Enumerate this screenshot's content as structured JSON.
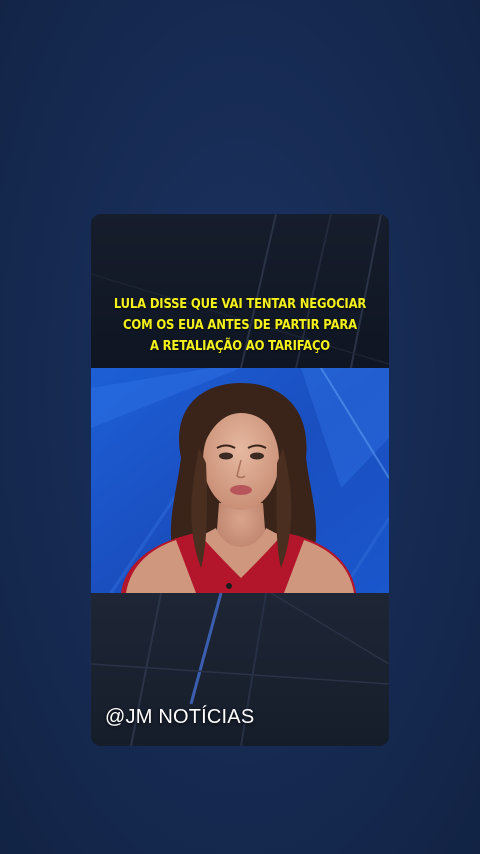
{
  "screen": {
    "background_color": "#172a4f"
  },
  "video": {
    "headline_lines": [
      "LULA DISSE QUE VAI TENTAR NEGOCIAR",
      "COM OS EUA ANTES DE PARTIR PARA",
      "A RETALIAÇÃO AO TARIFAÇO"
    ],
    "headline_color": "#f4f21a",
    "channel_handle": "@JM NOTÍCIAS",
    "studio_color": "#1a55c8",
    "presenter": {
      "top_color": "#b3152a",
      "hair_color": "#3a2419"
    }
  }
}
